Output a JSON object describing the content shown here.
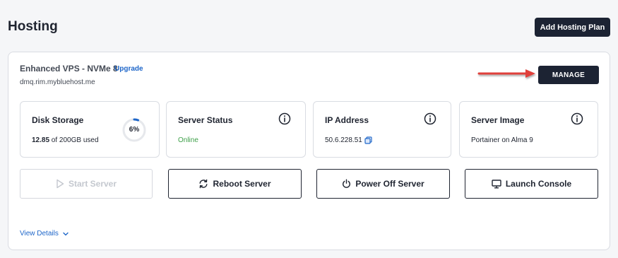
{
  "page": {
    "title": "Hosting",
    "add_plan_label": "Add Hosting Plan"
  },
  "plan": {
    "name": "Enhanced VPS - NVMe 8",
    "upgrade_label": "Upgrade",
    "domain": "dmq.rim.mybluehost.me",
    "manage_label": "MANAGE"
  },
  "stats": {
    "disk": {
      "title": "Disk Storage",
      "used": "12.85",
      "suffix": " of 200GB used",
      "percent": 6,
      "percent_label": "6%"
    },
    "status": {
      "title": "Server Status",
      "value": "Online"
    },
    "ip": {
      "title": "IP Address",
      "value": "50.6.228.51"
    },
    "image": {
      "title": "Server Image",
      "value": "Portainer on Alma 9"
    }
  },
  "actions": {
    "start": "Start Server",
    "reboot": "Reboot Server",
    "power_off": "Power Off Server",
    "console": "Launch Console"
  },
  "footer": {
    "view_details": "View Details"
  },
  "colors": {
    "primary_dark": "#1c2333",
    "link": "#1e66c9",
    "online": "#3fa04a",
    "annotation_arrow": "#e0413a",
    "gauge_fill": "#1e66c9"
  },
  "icons": {
    "info": "info-circle-icon",
    "copy": "copy-icon",
    "play": "play-icon",
    "reboot": "refresh-icon",
    "power": "power-icon",
    "console": "monitor-icon",
    "chevron": "chevron-down-icon"
  }
}
